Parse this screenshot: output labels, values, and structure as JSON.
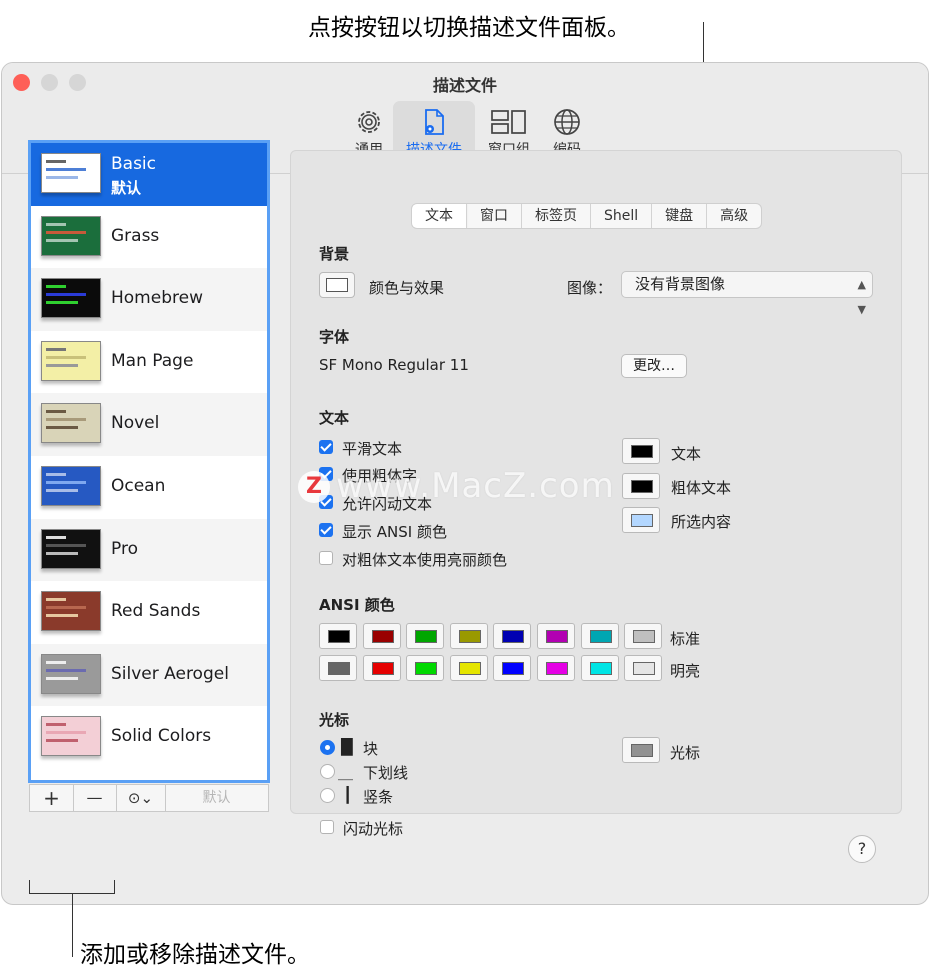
{
  "callouts": {
    "top": "点按按钮以切换描述文件面板。",
    "bottom": "添加或移除描述文件。"
  },
  "window": {
    "title": "描述文件",
    "traffic_colors": [
      "#fe5f57",
      "#d9d9d9",
      "#d9d9d9"
    ]
  },
  "toolbar": [
    {
      "label": "通用",
      "icon": "gear-icon"
    },
    {
      "label": "描述文件",
      "icon": "profile-document-icon",
      "active": true
    },
    {
      "label": "窗口组",
      "icon": "window-groups-icon"
    },
    {
      "label": "编码",
      "icon": "globe-icon"
    }
  ],
  "profiles": [
    {
      "name": "Basic",
      "default_label": "默认",
      "selected": true,
      "thumb": "#ffffff"
    },
    {
      "name": "Grass",
      "thumb": "#1b6e3c"
    },
    {
      "name": "Homebrew",
      "thumb": "#0b0b0b"
    },
    {
      "name": "Man Page",
      "thumb": "#f3efa6"
    },
    {
      "name": "Novel",
      "thumb": "#d9d4b8"
    },
    {
      "name": "Ocean",
      "thumb": "#2659c2"
    },
    {
      "name": "Pro",
      "thumb": "#111111"
    },
    {
      "name": "Red Sands",
      "thumb": "#8a3a2b"
    },
    {
      "name": "Silver Aerogel",
      "thumb": "#9a9a9a"
    },
    {
      "name": "Solid Colors",
      "thumb": "#f3cfd6"
    }
  ],
  "sidebar_buttons": {
    "add": "+",
    "remove": "—",
    "more": "⊙⌄",
    "default": "默认"
  },
  "tabs": [
    {
      "label": "文本",
      "active": true
    },
    {
      "label": "窗口"
    },
    {
      "label": "标签页"
    },
    {
      "label": "Shell"
    },
    {
      "label": "键盘"
    },
    {
      "label": "高级"
    }
  ],
  "background": {
    "section": "背景",
    "color_effects": "颜色与效果",
    "image_label": "图像：",
    "image_value": "没有背景图像"
  },
  "font": {
    "section": "字体",
    "value": "SF Mono Regular 11",
    "change": "更改…"
  },
  "text": {
    "section": "文本",
    "options": [
      {
        "label": "平滑文本",
        "checked": true
      },
      {
        "label": "使用粗体字",
        "checked": true
      },
      {
        "label": "允许闪动文本",
        "checked": true
      },
      {
        "label": "显示 ANSI 颜色",
        "checked": true
      },
      {
        "label": "对粗体文本使用亮丽颜色",
        "checked": false
      }
    ],
    "color_wells": [
      {
        "label": "文本",
        "color": "#000000"
      },
      {
        "label": "粗体文本",
        "color": "#000000"
      },
      {
        "label": "所选内容",
        "color": "#b3d7ff"
      }
    ]
  },
  "ansi": {
    "section": "ANSI 颜色",
    "normal_label": "标准",
    "bright_label": "明亮",
    "normal": [
      "#000000",
      "#990000",
      "#00a600",
      "#999900",
      "#0000b2",
      "#b200b2",
      "#00a6b2",
      "#bfbfbf"
    ],
    "bright": [
      "#666666",
      "#e50000",
      "#00d900",
      "#e5e500",
      "#0000ff",
      "#e500e5",
      "#00e5e5",
      "#e5e5e5"
    ]
  },
  "cursor": {
    "section": "光标",
    "styles": [
      {
        "glyph": "█",
        "label": "块",
        "selected": true
      },
      {
        "glyph": "＿",
        "label": "下划线"
      },
      {
        "glyph": "┃",
        "label": "竖条"
      }
    ],
    "blink": "闪动光标",
    "well_label": "光标",
    "well_color": "#929292"
  },
  "help": "?",
  "watermark": {
    "logo": "Z",
    "text": "www.MacZ.com"
  }
}
